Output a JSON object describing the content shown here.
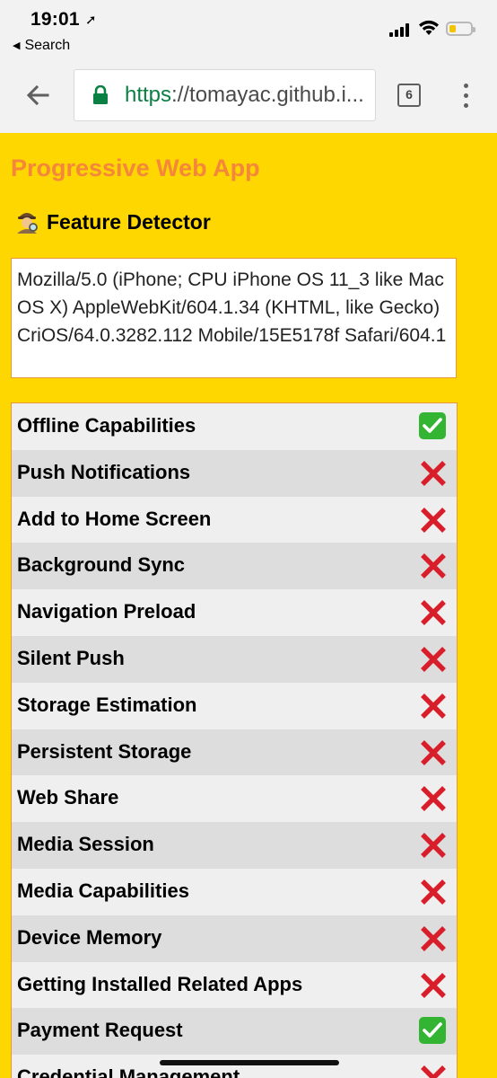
{
  "status_bar": {
    "time": "19:01",
    "back_app": "Search"
  },
  "browser": {
    "url_scheme": "https",
    "url_rest": "://tomayac.github.i...",
    "tab_count": "6"
  },
  "page": {
    "title": "Progressive Web App",
    "subtitle": "Feature Detector",
    "user_agent": "Mozilla/5.0 (iPhone; CPU iPhone OS 11_3 like Mac OS X) AppleWebKit/604.1.34 (KHTML, like Gecko) CriOS/64.0.3282.112 Mobile/15E5178f Safari/604.1",
    "colors": {
      "background": "#ffd700",
      "title": "#f5873a",
      "supported": "#33b533",
      "unsupported": "#d81e2a"
    },
    "features": [
      {
        "name": "Offline Capabilities",
        "supported": true
      },
      {
        "name": "Push Notifications",
        "supported": false
      },
      {
        "name": "Add to Home Screen",
        "supported": false
      },
      {
        "name": "Background Sync",
        "supported": false
      },
      {
        "name": "Navigation Preload",
        "supported": false
      },
      {
        "name": "Silent Push",
        "supported": false
      },
      {
        "name": "Storage Estimation",
        "supported": false
      },
      {
        "name": "Persistent Storage",
        "supported": false
      },
      {
        "name": "Web Share",
        "supported": false
      },
      {
        "name": "Media Session",
        "supported": false
      },
      {
        "name": "Media Capabilities",
        "supported": false
      },
      {
        "name": "Device Memory",
        "supported": false
      },
      {
        "name": "Getting Installed Related Apps",
        "supported": false
      },
      {
        "name": "Payment Request",
        "supported": true
      },
      {
        "name": "Credential Management",
        "supported": false
      }
    ]
  }
}
